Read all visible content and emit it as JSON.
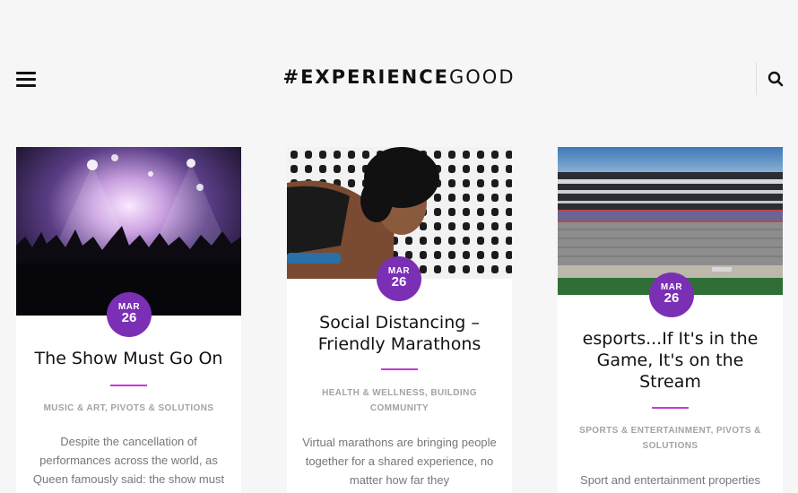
{
  "header": {
    "logo_bold": "#EXPERIENCE",
    "logo_light": "GOOD"
  },
  "colors": {
    "accent_purple": "#7b2fb5",
    "accent_pink": "#c63ad8",
    "background": "#f6f6f6"
  },
  "icons": {
    "menu": "hamburger-menu-icon",
    "search": "search-icon"
  },
  "cards": [
    {
      "month": "MAR",
      "day": "26",
      "title": "The Show Must Go On",
      "categories": "MUSIC & ART, PIVOTS & SOLUTIONS",
      "excerpt": "Despite the cancellation of performances across the world, as Queen famously said: the show must"
    },
    {
      "month": "MAR",
      "day": "26",
      "title": "Social Distancing – Friendly Marathons",
      "categories": "HEALTH & WELLNESS, BUILDING COMMUNITY",
      "excerpt": "Virtual marathons are bringing people together for a shared experience, no matter how far they"
    },
    {
      "month": "MAR",
      "day": "26",
      "title": "esports...If It's in the Game, It's on the Stream",
      "categories": "SPORTS & ENTERTAINMENT, PIVOTS & SOLUTIONS",
      "excerpt": "Sport and entertainment properties"
    }
  ]
}
